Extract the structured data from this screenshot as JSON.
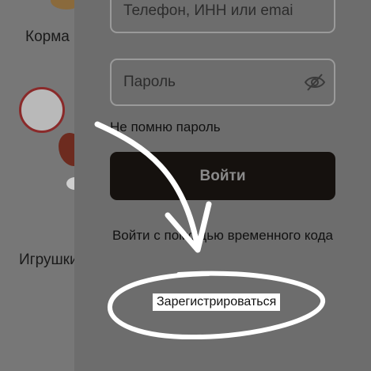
{
  "background": {
    "categories": [
      "Корма",
      "Игрушки"
    ]
  },
  "login_form": {
    "phone_placeholder": "Телефон, ИНН или email",
    "password_placeholder": "Пароль",
    "forgot_password_label": "Не помню пароль",
    "login_button_label": "Войти",
    "temp_code_label": "Войти с помощью временного кода",
    "register_label": "Зарегистрироваться"
  },
  "icons": {
    "password_visibility": "eye-off-icon",
    "annotation_arrow": "hand-drawn-arrow-icon",
    "annotation_circle": "hand-drawn-circle-icon"
  },
  "colors": {
    "overlay": "#6d6d6d",
    "login_button_bg": "#15110e",
    "annotation": "#ffffff"
  }
}
